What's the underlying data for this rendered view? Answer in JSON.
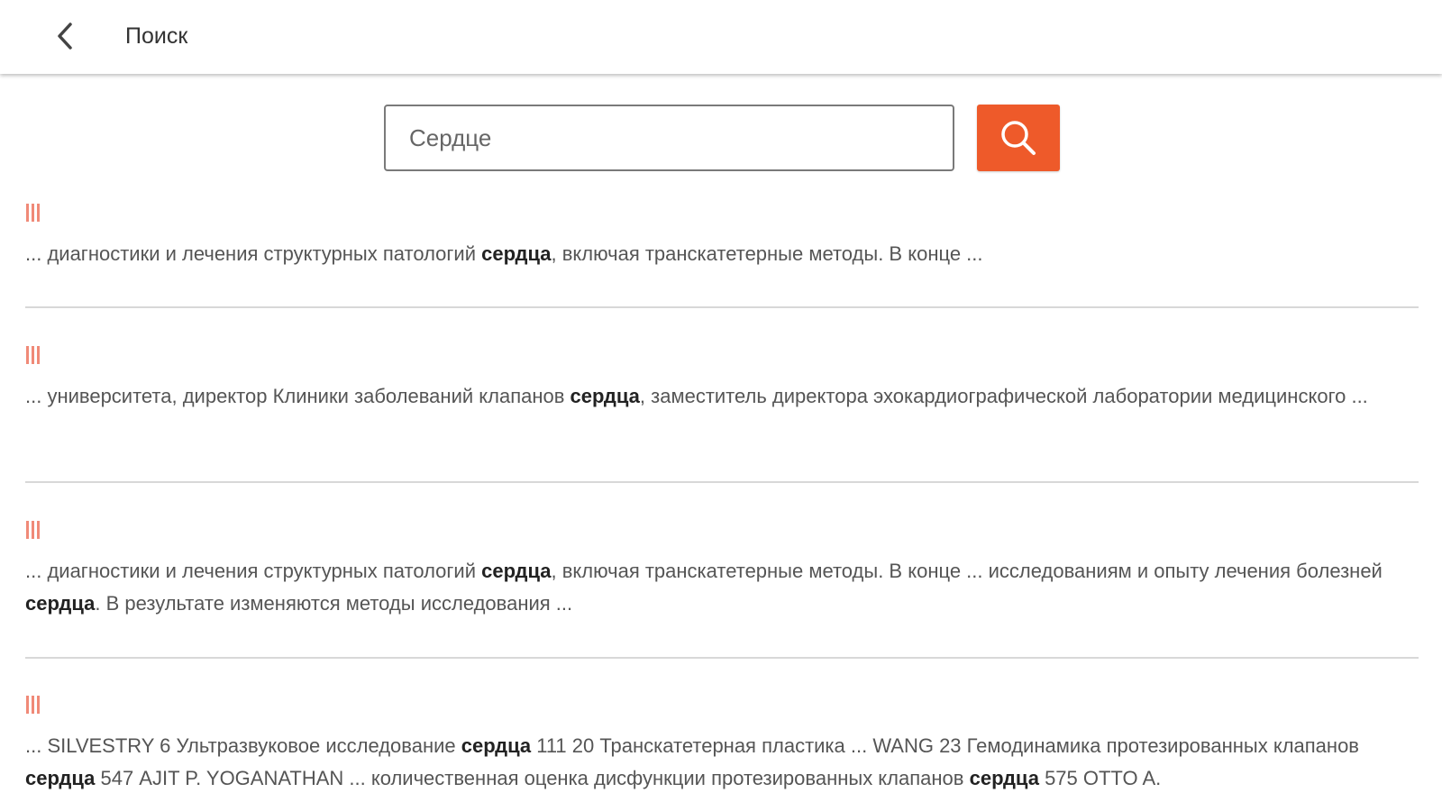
{
  "appbar": {
    "title": "Поиск",
    "back_icon": "chevron-left-icon"
  },
  "search": {
    "value": "Сердце",
    "button_icon": "search-icon",
    "accent_color": "#ee5a2a"
  },
  "result_marker_color": "#f08a78",
  "results": [
    {
      "segments": [
        {
          "text": "... диагностики и лечения структурных патологий ",
          "bold": false
        },
        {
          "text": "сердца",
          "bold": true
        },
        {
          "text": ", включая транскатетерные методы. В конце ...",
          "bold": false
        }
      ]
    },
    {
      "segments": [
        {
          "text": "... университета, директор Клиники заболеваний клапанов ",
          "bold": false
        },
        {
          "text": "сердца",
          "bold": true
        },
        {
          "text": ", заместитель директора эхокардиографической лаборатории медицинского ...",
          "bold": false
        }
      ]
    },
    {
      "segments": [
        {
          "text": "... диагностики и лечения структурных патологий ",
          "bold": false
        },
        {
          "text": "сердца",
          "bold": true
        },
        {
          "text": ", включая транскатетерные методы. В конце ... исследованиям и опыту лечения болезней ",
          "bold": false
        },
        {
          "text": "сердца",
          "bold": true
        },
        {
          "text": ". В результате изменяются методы исследования ...",
          "bold": false
        }
      ]
    },
    {
      "segments": [
        {
          "text": "... SILVESTRY 6 Ультразвуковое исследование ",
          "bold": false
        },
        {
          "text": "сердца",
          "bold": true
        },
        {
          "text": " 111 20 Транскатетерная пластика ... WANG 23 Гемодинамика протезированных клапанов ",
          "bold": false
        },
        {
          "text": "сердца",
          "bold": true
        },
        {
          "text": " 547 AJIT P. YOGANATHAN ... количественная оценка дисфункции протезированных клапанов ",
          "bold": false
        },
        {
          "text": "сердца",
          "bold": true
        },
        {
          "text": " 575 OTTO A.",
          "bold": false
        }
      ]
    }
  ]
}
